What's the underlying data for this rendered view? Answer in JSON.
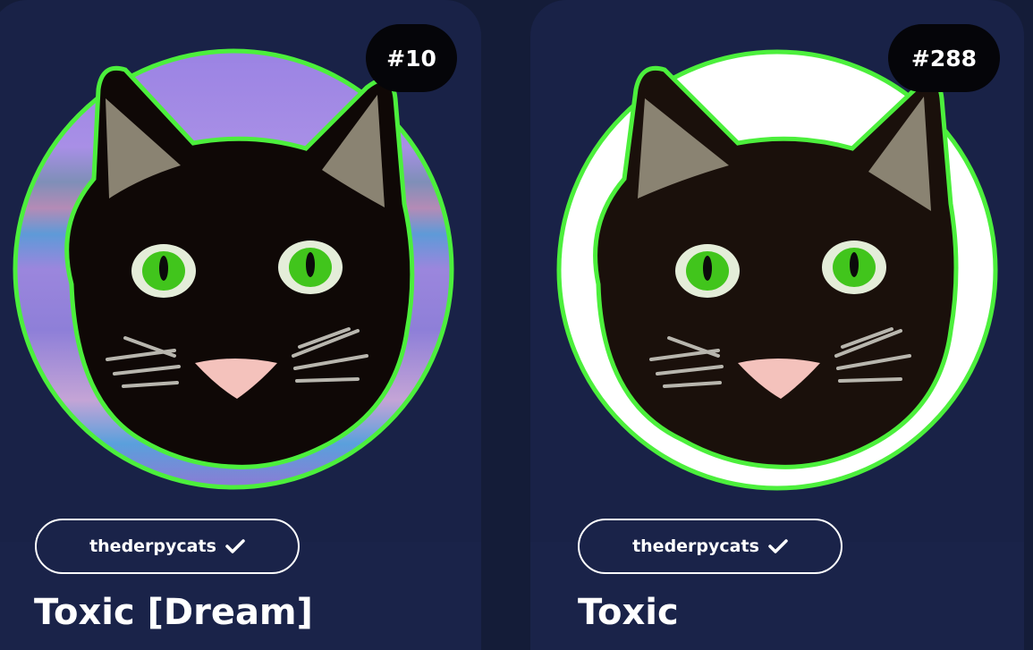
{
  "cards": [
    {
      "number": "#10",
      "creator": "thederpycats",
      "verified_icon": "checkmark-icon",
      "title": "Toxic [Dream]",
      "art_background": "pastel-gradient",
      "cat_color": "#0f0806",
      "outline_color": "#4cef3c"
    },
    {
      "number": "#288",
      "creator": "thederpycats",
      "verified_icon": "checkmark-icon",
      "title": "Toxic",
      "art_background": "#ffffff",
      "cat_color": "#1a100b",
      "outline_color": "#4cef3c"
    }
  ]
}
